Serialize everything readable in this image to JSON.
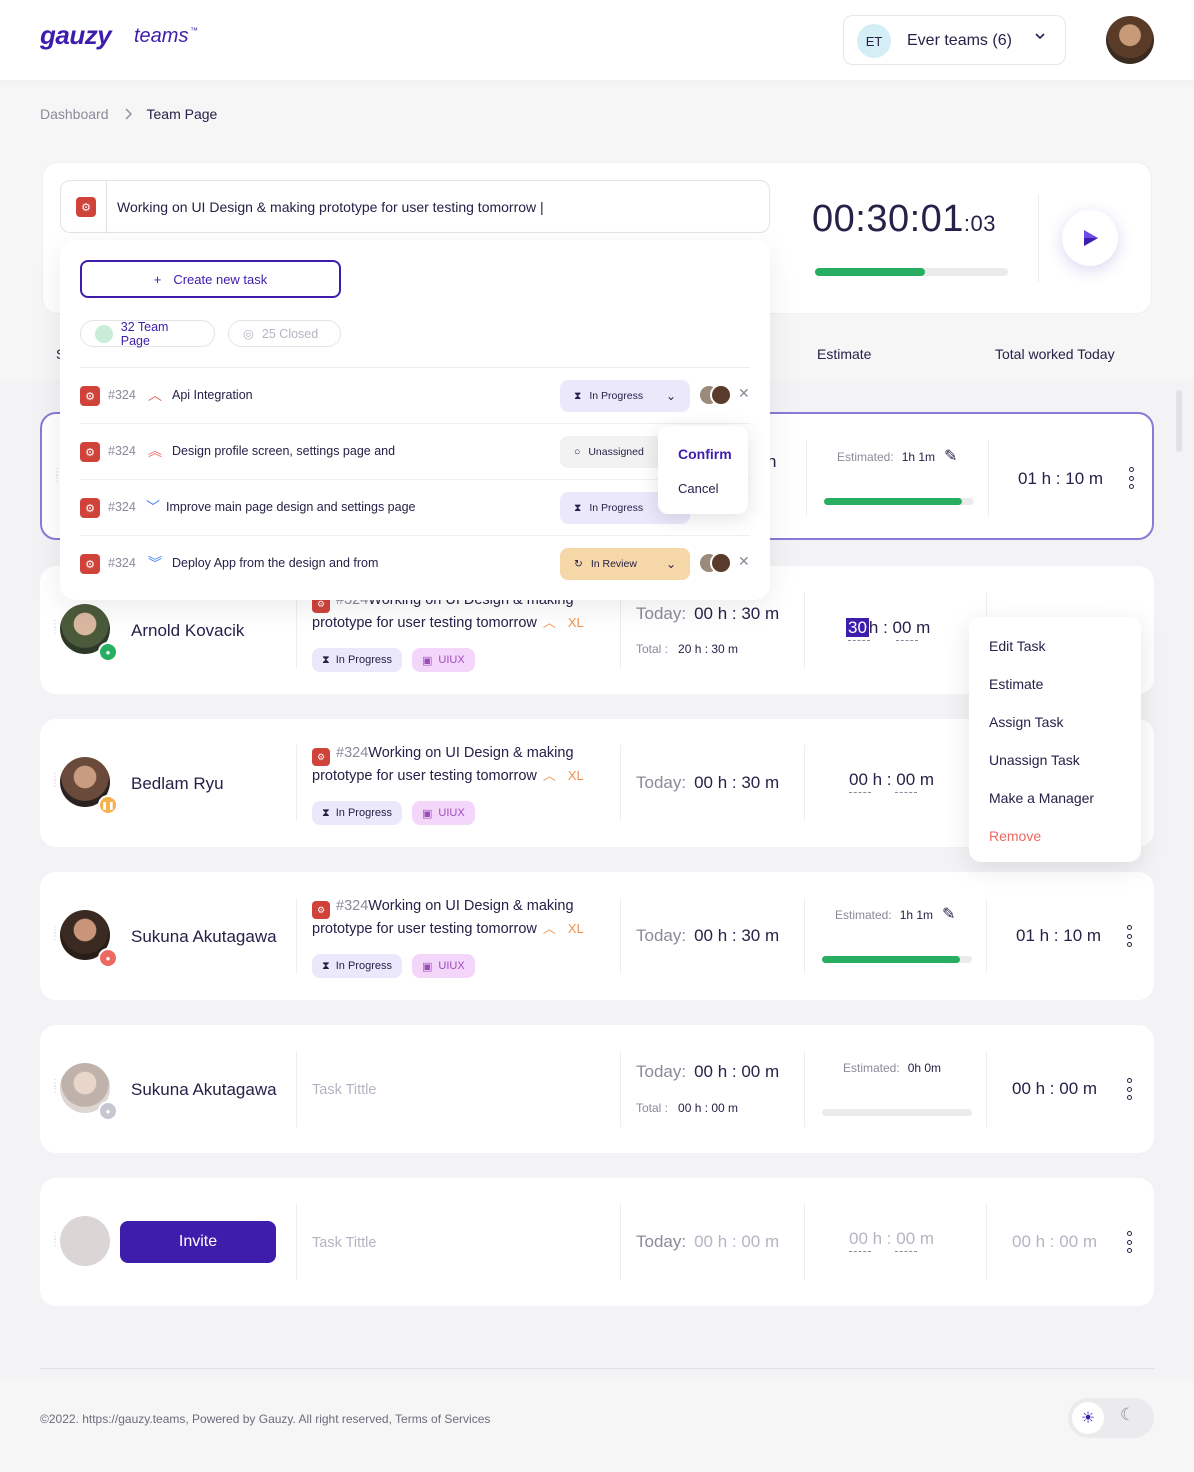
{
  "header": {
    "logo": "gauzy",
    "logo_sub": "teams",
    "logo_tm": "™",
    "team_initials": "ET",
    "team_name": "Ever teams (6)"
  },
  "breadcrumb": {
    "root": "Dashboard",
    "current": "Team Page"
  },
  "timer": {
    "task_text": "Working on UI Design & making prototype for user testing tomorrow |",
    "time": "00:30:01",
    "ms": ":03",
    "progress": 0.57
  },
  "columns": {
    "s": "S",
    "estimate": "Estimate",
    "total_today": "Total worked Today"
  },
  "dropdown": {
    "create_label": "Create new task",
    "filter_active": "32 Team Page",
    "filter_closed": "25 Closed",
    "tasks": [
      {
        "num": "#324",
        "label": "Api Integration",
        "status": "In Progress",
        "priority": "up"
      },
      {
        "num": "#324",
        "label": "Design profile screen, settings page and",
        "status": "Unassigned",
        "priority": "double-up"
      },
      {
        "num": "#324",
        "label": "Improve main page design and settings page",
        "status": "In Progress",
        "priority": "down"
      },
      {
        "num": "#324",
        "label": "Deploy App from the design and from",
        "status": "In Review",
        "priority": "double-down"
      }
    ],
    "confirm": "Confirm",
    "cancel": "Cancel"
  },
  "first_row": {
    "estimated_label": "Estimated:",
    "estimated_value": "1h 1m",
    "worked": "01 h : 10 m",
    "partial": "n",
    "progress": 0.92
  },
  "members": [
    {
      "name": "Arnold Kovacik",
      "task_num": "#324",
      "task_title": "Working on UI Design & making prototype for user testing tomorrow",
      "size": "XL",
      "status": "In Progress",
      "tag": "UIUX",
      "today_label": "Today:",
      "today": "00 h : 30 m",
      "total_label": "Total :",
      "total": "20 h : 30 m",
      "est_h": "30",
      "est_rest": "h : 00 m"
    },
    {
      "name": "Bedlam Ryu",
      "task_num": "#324",
      "task_title": "Working on UI Design & making prototype for user testing tomorrow",
      "size": "XL",
      "status": "In Progress",
      "tag": "UIUX",
      "today_label": "Today:",
      "today": "00 h : 30 m",
      "est": "00 h : 00 m"
    },
    {
      "name": "Sukuna Akutagawa",
      "task_num": "#324",
      "task_title": "Working on UI Design & making prototype for user testing tomorrow",
      "size": "XL",
      "status": "In Progress",
      "tag": "UIUX",
      "today_label": "Today:",
      "today": "00 h : 30 m",
      "estimated_label": "Estimated:",
      "estimated_value": "1h 1m",
      "worked": "01 h : 10 m",
      "progress": 0.92
    },
    {
      "name": "Sukuna Akutagawa",
      "task_title": "Task Tittle",
      "today_label": "Today:",
      "today": "00 h : 00 m",
      "total_label": "Total :",
      "total": "00 h : 00 m",
      "estimated_label": "Estimated:",
      "estimated_value": "0h 0m",
      "worked": "00 h : 00 m",
      "progress": 0
    }
  ],
  "invite": {
    "button": "Invite",
    "task_title": "Task Tittle",
    "today_label": "Today:",
    "today": "00 h : 00 m",
    "est": "00 h : 00 m",
    "worked": "00 h : 00 m"
  },
  "context_menu": [
    "Edit Task",
    "Estimate",
    "Assign Task",
    "Unassign Task",
    "Make a Manager",
    "Remove"
  ],
  "footer": {
    "text": "©2022. https://gauzy.teams, Powered by Gauzy. All right reserved, Terms of Services"
  },
  "colors": {
    "primary": "#3e1dad",
    "success": "#27ae60",
    "danger": "#eb6961",
    "warning": "#f3914d"
  }
}
